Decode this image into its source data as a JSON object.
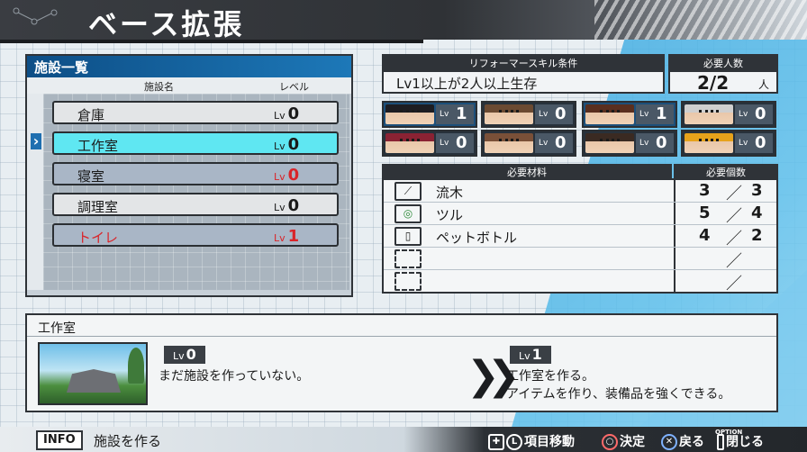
{
  "header": {
    "title": "ベース拡張"
  },
  "facilities": {
    "panel_title": "施設一覧",
    "col_name": "施設名",
    "col_level": "レベル",
    "lv_prefix": "Lv",
    "items": [
      {
        "name": "倉庫",
        "level": "0",
        "state": "normal"
      },
      {
        "name": "工作室",
        "level": "0",
        "state": "selected"
      },
      {
        "name": "寝室",
        "level": "0",
        "state": "dim-red-level"
      },
      {
        "name": "調理室",
        "level": "0",
        "state": "normal"
      },
      {
        "name": "トイレ",
        "level": "1",
        "state": "dim-red"
      }
    ]
  },
  "skill": {
    "header": "リフォーマースキル条件",
    "value": "Lv1以上が2人以上生存"
  },
  "people": {
    "header": "必要人数",
    "value": "2/2",
    "unit": "人"
  },
  "characters": [
    {
      "level": "1",
      "hair": "#1d1d22",
      "highlight": true
    },
    {
      "level": "0",
      "hair": "#6b4a32",
      "highlight": false
    },
    {
      "level": "1",
      "hair": "#5a2f1f",
      "highlight": true
    },
    {
      "level": "0",
      "hair": "#cfcfcf",
      "highlight": false
    },
    {
      "level": "0",
      "hair": "#8a2233",
      "highlight": false
    },
    {
      "level": "0",
      "hair": "#7a5038",
      "highlight": false
    },
    {
      "level": "0",
      "hair": "#3a2a22",
      "highlight": false
    },
    {
      "level": "0",
      "hair": "#e6a21b",
      "highlight": false
    }
  ],
  "materials": {
    "header_name": "必要材料",
    "header_count": "必要個数",
    "items": [
      {
        "name": "流木",
        "have": "3",
        "need": "3",
        "icon": "driftwood-icon"
      },
      {
        "name": "ツル",
        "have": "5",
        "need": "4",
        "icon": "vine-icon"
      },
      {
        "name": "ペットボトル",
        "have": "4",
        "need": "2",
        "icon": "bottle-icon"
      },
      {
        "name": "",
        "have": "",
        "need": "",
        "icon": "empty-slot-icon"
      },
      {
        "name": "",
        "have": "",
        "need": "",
        "icon": "empty-slot-icon"
      }
    ]
  },
  "detail": {
    "title": "工作室",
    "current_level": "0",
    "current_text": "まだ施設を作っていない。",
    "next_level": "1",
    "next_text_1": "工作室を作る。",
    "next_text_2": "アイテムを作り、装備品を強くできる。"
  },
  "footer": {
    "info_label": "INFO",
    "info_text": "施設を作る",
    "move": "項目移動",
    "confirm": "決定",
    "back": "戻る",
    "close": "閉じる",
    "option": "OPTION"
  }
}
